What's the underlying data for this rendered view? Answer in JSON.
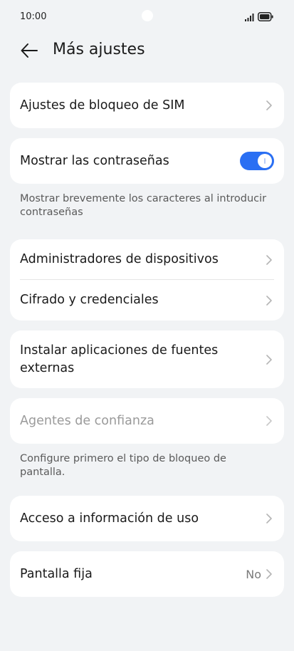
{
  "status_bar": {
    "time": "10:00"
  },
  "header": {
    "title": "Más ajustes"
  },
  "items": {
    "sim_lock": "Ajustes de bloqueo de SIM",
    "show_passwords": "Mostrar las contraseñas",
    "show_passwords_hint": "Mostrar brevemente los caracteres al introducir contraseñas",
    "show_passwords_on": true,
    "device_admins": "Administradores de dispositivos",
    "encryption": "Cifrado y credenciales",
    "install_external_line1": "Instalar aplicaciones de fuentes",
    "install_external_line2": "externas",
    "trust_agents": "Agentes de confianza",
    "trust_agents_hint": "Configure primero el tipo de bloqueo de pantalla.",
    "usage_access": "Acceso a información de uso",
    "screen_pinning": "Pantalla fija",
    "screen_pinning_value": "No"
  },
  "colors": {
    "accent": "#2a6ff3",
    "background": "#f1f3f5",
    "card": "#ffffff"
  }
}
